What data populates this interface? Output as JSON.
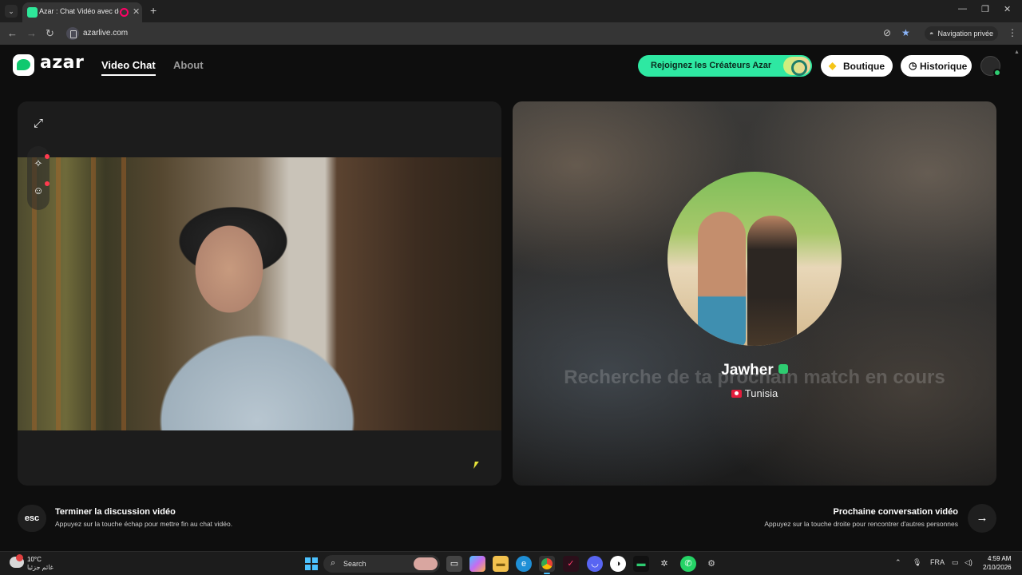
{
  "browser": {
    "tab_title": "Azar : Chat Vidéo avec de n",
    "url": "azarlive.com",
    "private_label": "Navigation privée",
    "icons": [
      "tab-list-icon",
      "azar-favicon",
      "recording-icon",
      "close-icon",
      "plus-icon",
      "minimize-icon",
      "maximize-icon",
      "close-window-icon",
      "back-icon",
      "forward-icon",
      "reload-icon",
      "site-info-icon",
      "eye-off-icon",
      "star-icon",
      "incognito-icon",
      "more-icon"
    ]
  },
  "header": {
    "logo_text": "azar",
    "nav": [
      {
        "label": "Video Chat",
        "active": true
      },
      {
        "label": "About",
        "active": false
      }
    ],
    "creators_label": "Rejoignez les Créateurs Azar",
    "shop_label": "Boutique",
    "history_label": "Historique",
    "accent_color": "#2ee8a2"
  },
  "left_panel": {
    "icons": [
      "expand-icon",
      "magic-wand-icon",
      "sticker-icon"
    ]
  },
  "right_panel": {
    "searching_text": "Recherche de ta prochain match en cours",
    "match_name": "Jawher",
    "match_country": "Tunisia"
  },
  "bottom": {
    "esc_key": "esc",
    "end_title": "Terminer la discussion vidéo",
    "end_sub": "Appuyez sur la touche échap pour mettre fin au chat vidéo.",
    "next_title": "Prochaine conversation vidéo",
    "next_sub": "Appuyez sur la touche droite pour rencontrer d'autres personnes"
  },
  "taskbar": {
    "weather_temp": "10°C",
    "weather_desc": "غائم جزئيا",
    "search_label": "Search",
    "language": "FRA",
    "time": "4:59 AM",
    "date": "2/10/2026",
    "apps": [
      "file-explorer-icon",
      "copilot-icon",
      "folder-icon",
      "edge-icon",
      "chrome-icon",
      "app-icon",
      "discord-icon",
      "clock-app-icon",
      "terminal-icon",
      "chatgpt-icon",
      "whatsapp-icon",
      "settings-icon"
    ]
  }
}
